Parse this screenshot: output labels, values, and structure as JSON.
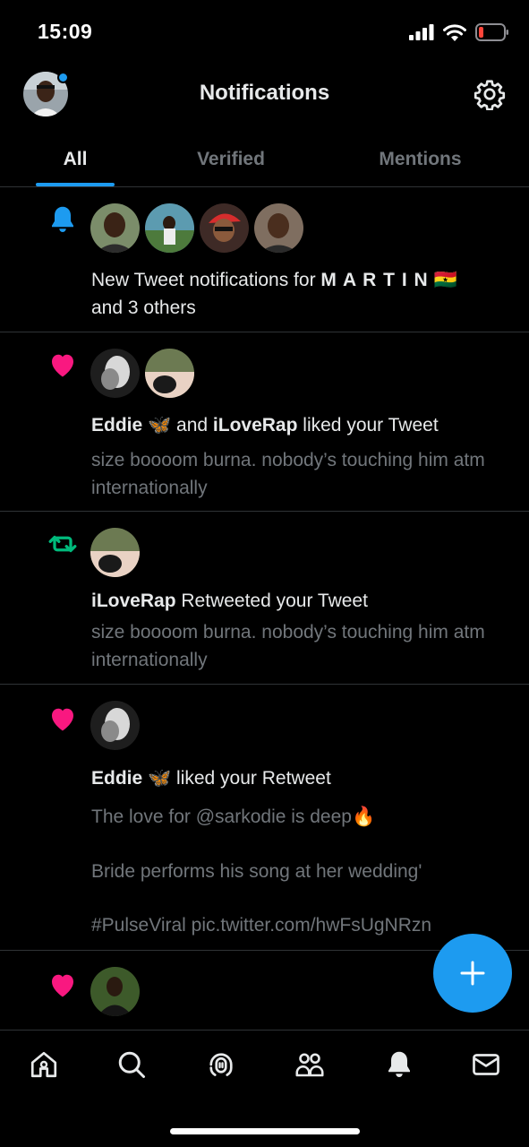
{
  "status": {
    "time": "15:09"
  },
  "header": {
    "title": "Notifications"
  },
  "tabs": [
    {
      "label": "All",
      "active": true
    },
    {
      "label": "Verified",
      "active": false
    },
    {
      "label": "Mentions",
      "active": false
    }
  ],
  "notifications": [
    {
      "type": "new-tweet",
      "icon": "bell-icon",
      "prefix": "New Tweet notifications for ",
      "name": "M A R T I N",
      "flag": "🇬🇭",
      "suffix": "and 3 others"
    },
    {
      "type": "like",
      "icon": "heart-icon",
      "name1": "Eddie",
      "emoji": "🦋",
      "joiner": "and",
      "name2": "iLoveRap",
      "action": "liked your Tweet",
      "tweet_text": "size boooom burna. nobody’s touching him atm internationally"
    },
    {
      "type": "retweet",
      "icon": "retweet-icon",
      "name": "iLoveRap",
      "action": "Retweeted your Tweet",
      "tweet_text": "size boooom burna. nobody’s touching him atm internationally"
    },
    {
      "type": "like",
      "icon": "heart-icon",
      "name": "Eddie",
      "emoji": "🦋",
      "action": "liked your Retweet",
      "line1": "The love for @sarkodie is deep🔥",
      "line2": "Bride performs his song at her wedding'",
      "line3": "#PulseViral pic.twitter.com/hwFsUgNRzn"
    },
    {
      "type": "like",
      "icon": "heart-icon"
    }
  ],
  "colors": {
    "accent": "#1d9bf0",
    "like": "#f91880",
    "retweet": "#00ba7c",
    "muted": "#71767b"
  },
  "nav": [
    "home-icon",
    "search-icon",
    "spaces-icon",
    "communities-icon",
    "bell-icon",
    "mail-icon"
  ]
}
